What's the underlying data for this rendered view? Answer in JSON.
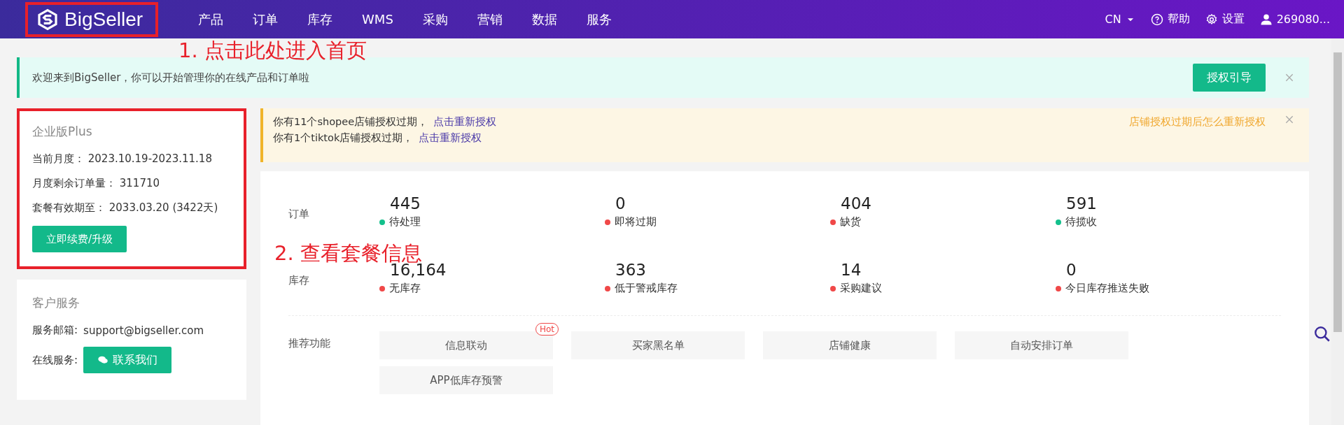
{
  "header": {
    "logo": {
      "text": "BigSeller",
      "highlighted": true
    },
    "nav": [
      {
        "label": "产品"
      },
      {
        "label": "订单"
      },
      {
        "label": "库存"
      },
      {
        "label": "WMS"
      },
      {
        "label": "采购"
      },
      {
        "label": "营销"
      },
      {
        "label": "数据"
      },
      {
        "label": "服务"
      }
    ],
    "language": "CN",
    "help": "帮助",
    "settings": "设置",
    "user": "269080..."
  },
  "welcome_banner": {
    "text": "欢迎来到BigSeller，你可以开始管理你的在线产品和订单啦",
    "button": "授权引导"
  },
  "plan_card": {
    "title": "企业版Plus",
    "highlighted": true,
    "rows": [
      {
        "label": "当前月度：",
        "value": "2023.10.19-2023.11.18"
      },
      {
        "label": "月度剩余订单量：",
        "value": "311710"
      },
      {
        "label": "套餐有效期至：",
        "value": "2033.03.20 (3422天)"
      }
    ],
    "button": "立即续费/升级"
  },
  "service_card": {
    "title": "客户服务",
    "email_label": "服务邮箱:",
    "email": "support@bigseller.com",
    "online_label": "在线服务:",
    "button": "联系我们"
  },
  "auth_notice": {
    "lines": [
      {
        "text": "你有11个shopee店铺授权过期，",
        "link": "点击重新授权"
      },
      {
        "text": "你有1个tiktok店铺授权过期，",
        "link": "点击重新授权"
      }
    ],
    "help_link": "店铺授权过期后怎么重新授权"
  },
  "stats": [
    {
      "label": "订单",
      "items": [
        {
          "value": "445",
          "label": "待处理",
          "color": "#13c08c"
        },
        {
          "value": "0",
          "label": "即将过期",
          "color": "#f04848"
        },
        {
          "value": "404",
          "label": "缺货",
          "color": "#f04848"
        },
        {
          "value": "591",
          "label": "待揽收",
          "color": "#13c08c"
        }
      ]
    },
    {
      "label": "库存",
      "items": [
        {
          "value": "16,164",
          "label": "无库存",
          "color": "#f04848"
        },
        {
          "value": "363",
          "label": "低于警戒库存",
          "color": "#f04848"
        },
        {
          "value": "14",
          "label": "采购建议",
          "color": "#f04848"
        },
        {
          "value": "0",
          "label": "今日库存推送失败",
          "color": "#f04848"
        }
      ]
    }
  ],
  "features": {
    "label": "推荐功能",
    "items": [
      {
        "label": "信息联动",
        "badge": "Hot"
      },
      {
        "label": "买家黑名单"
      },
      {
        "label": "店铺健康"
      },
      {
        "label": "自动安排订单"
      },
      {
        "label": "APP低库存预警"
      }
    ]
  },
  "annotations": [
    {
      "text": "1. 点击此处进入首页"
    },
    {
      "text": "2. 查看套餐信息"
    }
  ]
}
